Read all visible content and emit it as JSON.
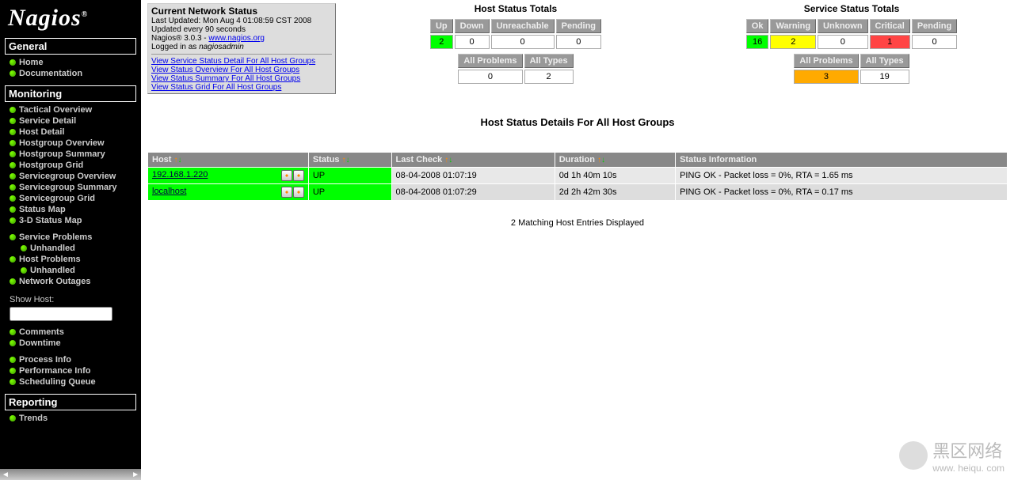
{
  "logo": "Nagios",
  "sidebar": {
    "general": {
      "title": "General",
      "items": [
        "Home",
        "Documentation"
      ]
    },
    "monitoring": {
      "title": "Monitoring",
      "items": [
        "Tactical Overview",
        "Service Detail",
        "Host Detail",
        "Hostgroup Overview",
        "Hostgroup Summary",
        "Hostgroup Grid",
        "Servicegroup Overview",
        "Servicegroup Summary",
        "Servicegroup Grid",
        "Status Map",
        "3-D Status Map"
      ],
      "problems": [
        {
          "t": "Service Problems",
          "sub": false
        },
        {
          "t": "Unhandled",
          "sub": true
        },
        {
          "t": "Host Problems",
          "sub": false
        },
        {
          "t": "Unhandled",
          "sub": true
        },
        {
          "t": "Network Outages",
          "sub": false
        }
      ],
      "show_host_label": "Show Host:",
      "extras": [
        "Comments",
        "Downtime"
      ],
      "process": [
        "Process Info",
        "Performance Info",
        "Scheduling Queue"
      ]
    },
    "reporting": {
      "title": "Reporting",
      "items": [
        "Trends"
      ]
    }
  },
  "info_box": {
    "title": "Current Network Status",
    "last_updated": "Last Updated: Mon Aug 4 01:08:59 CST 2008",
    "refresh": "Updated every 90 seconds",
    "version_pre": "Nagios® 3.0.3 - ",
    "version_link": "www.nagios.org",
    "logged_pre": "Logged in as ",
    "logged_user": "nagiosadmin",
    "links": [
      "View Service Status Detail For All Host Groups",
      "View Status Overview For All Host Groups",
      "View Status Summary For All Host Groups",
      "View Status Grid For All Host Groups"
    ]
  },
  "host_totals": {
    "title": "Host Status Totals",
    "cols": [
      "Up",
      "Down",
      "Unreachable",
      "Pending"
    ],
    "vals": [
      "2",
      "0",
      "0",
      "0"
    ],
    "sum_cols": [
      "All Problems",
      "All Types"
    ],
    "sum_vals": [
      "0",
      "2"
    ]
  },
  "service_totals": {
    "title": "Service Status Totals",
    "cols": [
      "Ok",
      "Warning",
      "Unknown",
      "Critical",
      "Pending"
    ],
    "vals": [
      "16",
      "2",
      "0",
      "1",
      "0"
    ],
    "sum_cols": [
      "All Problems",
      "All Types"
    ],
    "sum_vals": [
      "3",
      "19"
    ]
  },
  "page_title": "Host Status Details For All Host Groups",
  "status_table": {
    "headers": [
      "Host",
      "Status",
      "Last Check",
      "Duration",
      "Status Information"
    ],
    "rows": [
      {
        "host": "192.168.1.220",
        "status": "UP",
        "last": "08-04-2008 01:07:19",
        "dur": "0d 1h 40m 10s",
        "info": "PING OK - Packet loss = 0%, RTA = 1.65 ms"
      },
      {
        "host": "localhost",
        "status": "UP",
        "last": "08-04-2008 01:07:29",
        "dur": "2d 2h 42m 30s",
        "info": "PING OK - Packet loss = 0%, RTA = 0.17 ms"
      }
    ]
  },
  "matching": "2 Matching Host Entries Displayed",
  "watermark": {
    "big": "黑区网络",
    "small": "www. heiqu. com"
  }
}
